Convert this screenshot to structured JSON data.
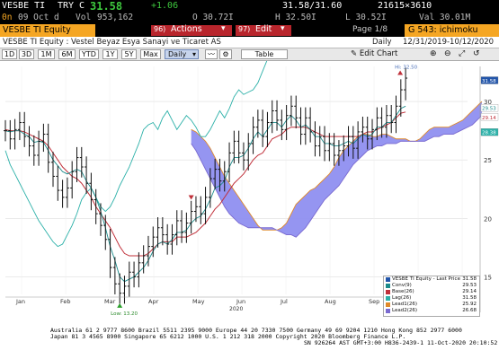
{
  "header": {
    "ticker": "VESBE TI",
    "currency": "TRY",
    "price_prefix": "C",
    "last_price": "31.58",
    "change": "+1.06",
    "bid_ask": "31.58/31.60",
    "size": "21615×3610",
    "row2_prefix": "0n",
    "row2_time": "09 Oct d",
    "volume_label": "Vol",
    "volume": "953,162",
    "open": "O 30.72I",
    "high": "H 32.50I",
    "low": "L 30.52I",
    "value": "Val 30.01M",
    "security": "VESBE TI Equity",
    "actions_num": "96)",
    "actions_label": "Actions",
    "edit_num": "97)",
    "edit_label": "Edit",
    "page_label": "Page 1/8",
    "study_label": "G 543: ichimoku",
    "company_title": "VESBE TI Equity : Vestel Beyaz Esya Sanayi ve Ticaret AS",
    "period_label": "Daily",
    "date_range": "12/31/2019-10/12/2020"
  },
  "toolbar": {
    "ranges": [
      "1D",
      "3D",
      "1M",
      "6M",
      "YTD",
      "1Y",
      "5Y",
      "Max"
    ],
    "frequency": "Daily",
    "table_label": "Table",
    "edit_chart_label": "Edit Chart"
  },
  "chart_data": {
    "type": "line",
    "y_ticks": [
      15,
      20,
      25,
      30
    ],
    "ylim": [
      13.5,
      33
    ],
    "x_tick_labels": [
      "Jan",
      "Feb",
      "Mar",
      "Apr",
      "May",
      "Jun",
      "Jul",
      "Aug",
      "Sep",
      "Oct",
      "Nov"
    ],
    "x_year_label": "2020",
    "low_annotation": "Low: 13.20",
    "high_annotation": "Hi: 32.50",
    "price": [
      27.5,
      26.8,
      27.6,
      28.2,
      27.0,
      26.2,
      25.4,
      26.6,
      27.2,
      24.8,
      23.6,
      22.4,
      21.8,
      22.6,
      24.0,
      25.2,
      24.4,
      23.0,
      21.6,
      20.4,
      19.4,
      18.2,
      15.8,
      14.4,
      13.6,
      14.2,
      15.4,
      15.0,
      16.2,
      16.8,
      17.6,
      18.4,
      19.2,
      18.6,
      17.8,
      18.6,
      19.8,
      18.8,
      19.6,
      20.6,
      21.0,
      20.4,
      21.8,
      23.4,
      24.2,
      23.2,
      24.0,
      25.6,
      26.6,
      25.6,
      25.0,
      26.4,
      27.8,
      28.4,
      27.0,
      28.2,
      29.2,
      28.4,
      27.6,
      28.8,
      29.6,
      28.6,
      27.2,
      28.6,
      27.4,
      26.2,
      27.0,
      25.8,
      26.4,
      25.4,
      25.8,
      26.2,
      27.0,
      26.0,
      27.4,
      27.8,
      26.8,
      27.6,
      28.6,
      27.8,
      28.8,
      28.2,
      29.6,
      31.0,
      32.0
    ],
    "conv": [
      27.5,
      27.4,
      27.5,
      27.5,
      27.2,
      27.0,
      26.5,
      26.6,
      26.5,
      25.8,
      25.0,
      24.5,
      24.0,
      23.8,
      24.0,
      24.2,
      24.0,
      23.2,
      22.6,
      21.8,
      20.6,
      19.2,
      17.6,
      16.4,
      15.0,
      14.6,
      14.8,
      15.0,
      15.4,
      15.8,
      16.4,
      17.2,
      17.8,
      18.0,
      17.8,
      18.2,
      18.8,
      18.8,
      19.0,
      19.6,
      20.0,
      20.2,
      20.8,
      21.6,
      22.6,
      22.8,
      23.2,
      24.4,
      25.2,
      25.2,
      25.4,
      26.0,
      26.8,
      27.4,
      27.0,
      27.6,
      28.2,
      28.2,
      27.8,
      28.4,
      28.8,
      28.4,
      27.8,
      28.0,
      27.6,
      27.0,
      27.0,
      26.4,
      26.4,
      26.2,
      26.2,
      26.4,
      26.6,
      26.4,
      26.8,
      27.2,
      27.0,
      27.2,
      27.8,
      27.8,
      28.2,
      28.2,
      28.8,
      29.4,
      29.6
    ],
    "base": [
      27.6,
      27.5,
      27.5,
      27.5,
      27.4,
      27.2,
      27.0,
      26.8,
      26.6,
      26.2,
      25.6,
      25.0,
      24.4,
      24.0,
      23.6,
      23.4,
      23.0,
      22.4,
      21.8,
      21.0,
      20.4,
      19.8,
      19.2,
      18.4,
      17.6,
      17.0,
      16.8,
      16.8,
      16.8,
      16.8,
      17.0,
      17.4,
      17.8,
      18.0,
      18.0,
      18.0,
      18.4,
      18.4,
      18.4,
      18.6,
      18.8,
      19.2,
      19.6,
      20.2,
      20.8,
      21.2,
      21.8,
      22.4,
      23.0,
      23.4,
      23.8,
      24.4,
      25.0,
      25.4,
      25.6,
      26.2,
      26.8,
      27.0,
      27.2,
      27.6,
      27.8,
      27.8,
      27.8,
      27.8,
      27.6,
      27.4,
      27.2,
      27.0,
      27.0,
      27.0,
      27.0,
      27.0,
      27.0,
      27.0,
      27.0,
      27.2,
      27.4,
      27.4,
      27.6,
      27.8,
      28.0,
      28.2,
      28.6,
      29.0,
      29.1
    ],
    "lag": [
      25.8,
      24.6,
      23.8,
      23.0,
      22.2,
      21.4,
      20.6,
      19.8,
      19.2,
      18.6,
      18.0,
      17.6,
      17.8,
      18.6,
      19.4,
      20.4,
      21.6,
      22.2,
      22.6,
      21.8,
      21.0,
      20.6,
      21.0,
      21.8,
      22.8,
      23.6,
      24.4,
      25.4,
      26.4,
      27.6,
      28.0,
      28.2,
      27.6,
      28.6,
      29.2,
      28.4,
      27.6,
      28.2,
      28.8,
      28.4,
      27.8,
      27.0,
      27.0,
      27.6,
      28.4,
      29.2,
      28.6,
      29.4,
      30.4,
      31.0,
      30.6,
      30.8,
      31.0,
      31.6,
      32.6,
      33.6,
      34.6,
      null,
      null,
      null,
      null,
      null,
      null,
      null,
      null,
      null,
      null,
      null,
      null,
      null,
      null,
      null,
      null,
      null,
      null,
      null,
      null,
      null,
      null,
      null,
      null,
      null,
      null,
      null,
      null
    ],
    "lead1": [
      null,
      null,
      null,
      null,
      null,
      null,
      null,
      null,
      null,
      null,
      null,
      null,
      null,
      null,
      null,
      null,
      null,
      null,
      null,
      null,
      null,
      null,
      null,
      null,
      null,
      null,
      27.6,
      27.4,
      27.0,
      26.6,
      26.0,
      25.2,
      24.4,
      23.6,
      23.0,
      22.4,
      21.8,
      21.2,
      20.6,
      20.0,
      19.4,
      19.0,
      19.0,
      19.0,
      19.0,
      19.2,
      19.6,
      20.4,
      21.2,
      21.6,
      22.0,
      22.4,
      22.6,
      23.0,
      23.4,
      23.8,
      24.4,
      25.2,
      25.8,
      26.2,
      26.6,
      27.0,
      27.2,
      27.2,
      27.0,
      27.0,
      27.2,
      27.2,
      27.0,
      26.8,
      26.8,
      26.8,
      26.6,
      26.6,
      26.8,
      27.2,
      27.6,
      27.8,
      27.8,
      27.8,
      27.8,
      28.0,
      28.2,
      28.4,
      28.8,
      29.2,
      29.6,
      30.0
    ],
    "lead2": [
      null,
      null,
      null,
      null,
      null,
      null,
      null,
      null,
      null,
      null,
      null,
      null,
      null,
      null,
      null,
      null,
      null,
      null,
      null,
      null,
      null,
      null,
      null,
      null,
      null,
      null,
      26.4,
      25.8,
      25.0,
      24.2,
      23.4,
      22.6,
      21.8,
      21.0,
      20.4,
      20.0,
      19.6,
      19.4,
      19.2,
      19.2,
      19.2,
      19.2,
      19.2,
      19.2,
      19.0,
      18.8,
      18.6,
      18.6,
      18.4,
      18.8,
      19.2,
      19.8,
      20.4,
      21.0,
      21.6,
      22.0,
      22.4,
      22.8,
      23.4,
      24.0,
      24.6,
      25.0,
      25.4,
      25.8,
      26.0,
      26.2,
      26.2,
      26.4,
      26.4,
      26.4,
      26.6,
      26.6,
      26.6,
      26.6,
      26.6,
      26.6,
      26.8,
      27.0,
      27.0,
      27.2,
      27.2,
      27.2,
      27.4,
      27.6,
      27.8,
      28.0,
      28.4,
      28.8
    ]
  },
  "price_labels": {
    "last": "31.58",
    "conv": "29.53",
    "base": "29.14",
    "lead": "28.38"
  },
  "legend": {
    "items": [
      {
        "label": "VESBE TI Equity - Last Price",
        "value": "31.58",
        "color": "#2255aa"
      },
      {
        "label": "Conv(9)",
        "value": "29.53",
        "color": "#1a8a8a"
      },
      {
        "label": "Base(26)",
        "value": "29.14",
        "color": "#c0303a"
      },
      {
        "label": "Lag(26)",
        "value": "31.58",
        "color": "#2bb0a8"
      },
      {
        "label": "Lead1(26)",
        "value": "25.92",
        "color": "#e08a2a"
      },
      {
        "label": "Lead2(26)",
        "value": "26.68",
        "color": "#7a6ad0"
      }
    ]
  },
  "footer": {
    "line1": "Australia 61 2 9777 8600  Brazil 5511 2395 9000  Europe 44 20 7330 7500  Germany 49 69 9204 1210  Hong Kong 852 2977 6000",
    "line2": "Japan 81 3 4565 8900        Singapore 65 6212 1000        U.S. 1 212 318 2000        Copyright 2020 Bloomberg Finance L.P.",
    "line3": "SN 926264 AST  GMT+3:00 H836-2439-1 11-Oct-2020 20:10:52"
  },
  "colors": {
    "amber": "#f5a623",
    "green": "#3ec83e",
    "cloud": "#8f8ff0",
    "bars": "#111111",
    "conv": "#1a8a8a",
    "base": "#c0303a",
    "lag": "#2bb0a8",
    "lead1": "#e08a2a",
    "lead2": "#7a6ad0"
  }
}
